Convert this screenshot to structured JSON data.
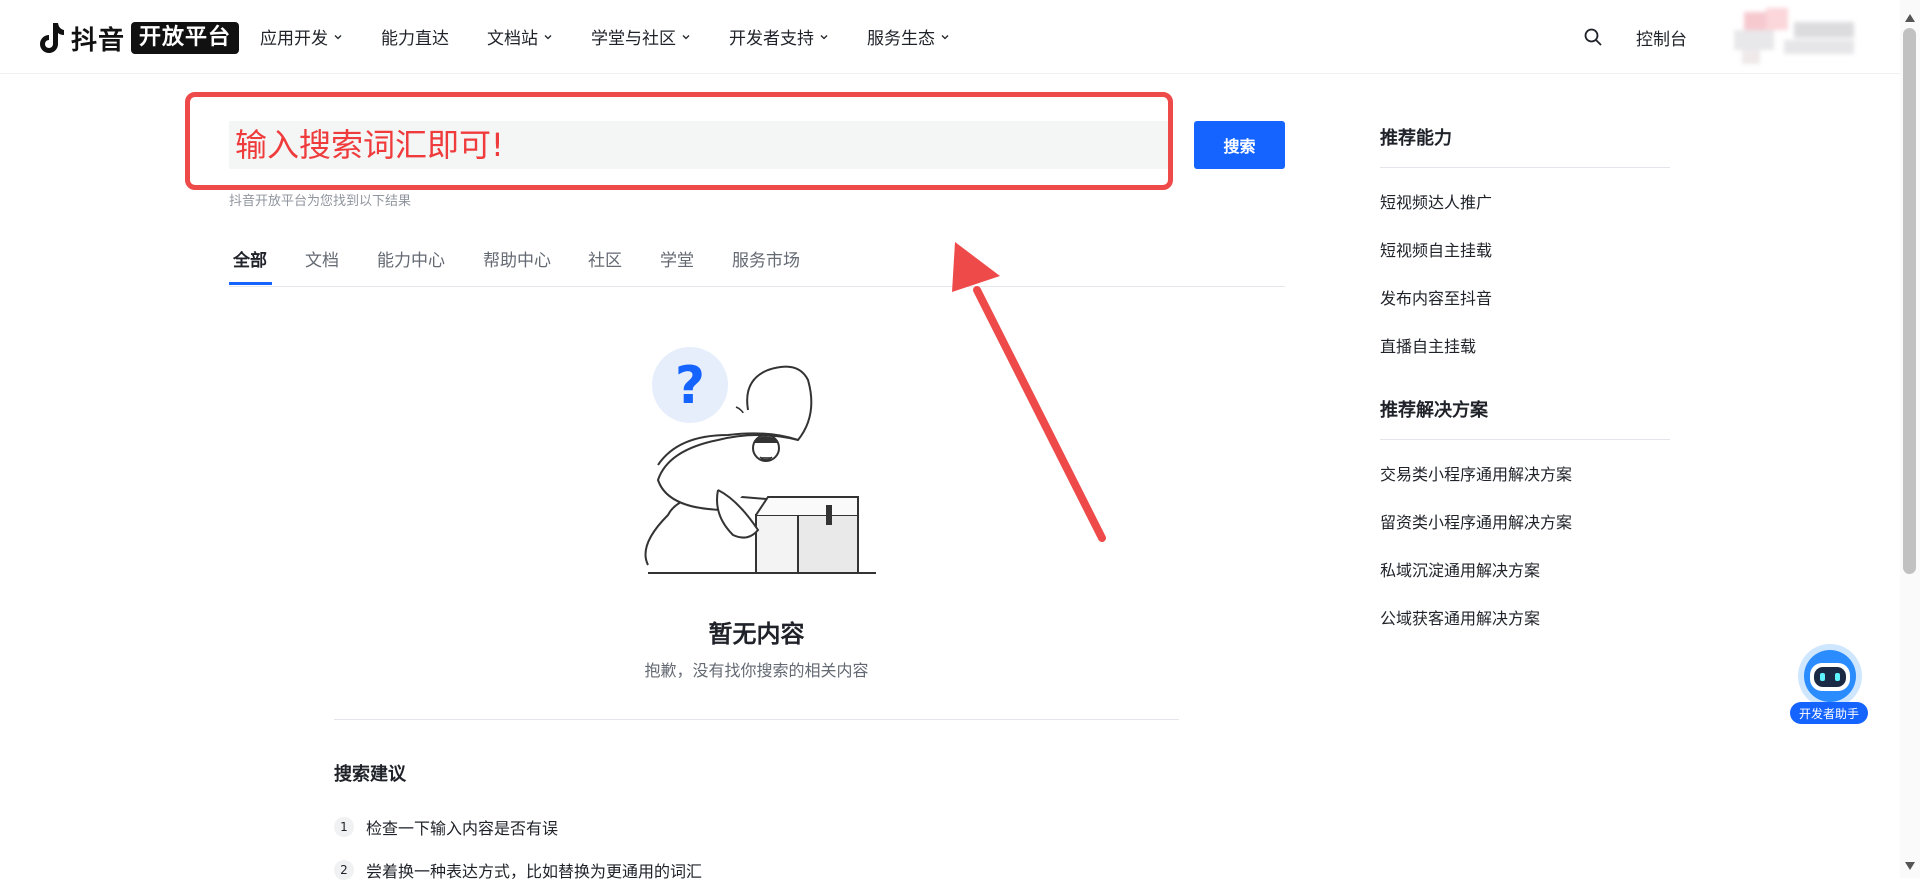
{
  "header": {
    "logo_text": "抖音",
    "logo_badge": "开放平台",
    "nav": [
      {
        "label": "应用开发",
        "has_dropdown": true
      },
      {
        "label": "能力直达",
        "has_dropdown": false
      },
      {
        "label": "文档站",
        "has_dropdown": true
      },
      {
        "label": "学堂与社区",
        "has_dropdown": true
      },
      {
        "label": "开发者支持",
        "has_dropdown": true
      },
      {
        "label": "服务生态",
        "has_dropdown": true
      }
    ],
    "console_label": "控制台"
  },
  "search": {
    "input_value": "输入搜索词汇即可!",
    "button_label": "搜索",
    "hint": "抖音开放平台为您找到以下结果"
  },
  "tabs": [
    {
      "label": "全部",
      "active": true
    },
    {
      "label": "文档",
      "active": false
    },
    {
      "label": "能力中心",
      "active": false
    },
    {
      "label": "帮助中心",
      "active": false
    },
    {
      "label": "社区",
      "active": false
    },
    {
      "label": "学堂",
      "active": false
    },
    {
      "label": "服务市场",
      "active": false
    }
  ],
  "empty": {
    "title": "暂无内容",
    "subtitle": "抱歉，没有找你搜索的相关内容"
  },
  "tips": {
    "title": "搜索建议",
    "items": [
      {
        "num": "1",
        "text": "检查一下输入内容是否有误"
      },
      {
        "num": "2",
        "text": "尝着换一种表达方式，比如替换为更通用的词汇"
      }
    ]
  },
  "sidebar": {
    "capabilities_title": "推荐能力",
    "capabilities": [
      "短视频达人推广",
      "短视频自主挂载",
      "发布内容至抖音",
      "直播自主挂载"
    ],
    "solutions_title": "推荐解决方案",
    "solutions": [
      "交易类小程序通用解决方案",
      "留资类小程序通用解决方案",
      "私域沉淀通用解决方案",
      "公域获客通用解决方案"
    ]
  },
  "helper_bot": {
    "label": "开发者助手"
  },
  "colors": {
    "accent": "#1664ff",
    "annotation": "#ef4a4a"
  }
}
